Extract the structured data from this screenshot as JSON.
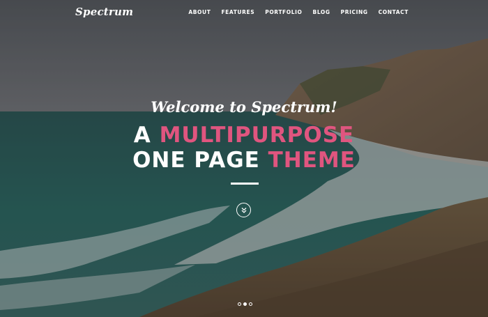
{
  "brand": {
    "name": "Spectrum"
  },
  "nav": {
    "items": [
      "ABOUT",
      "FEATURES",
      "PORTFOLIO",
      "BLOG",
      "PRICING",
      "CONTACT"
    ]
  },
  "hero": {
    "welcome": "Welcome to Spectrum!",
    "line1_a": "A ",
    "line1_b": "MULTIPURPOSE",
    "line2_a": "ONE PAGE ",
    "line2_b": "THEME",
    "scroll_icon": "chevron-double-down-icon"
  },
  "slider": {
    "count": 3,
    "active_index": 1
  },
  "colors": {
    "accent": "#e0557f",
    "text": "#ffffff"
  }
}
